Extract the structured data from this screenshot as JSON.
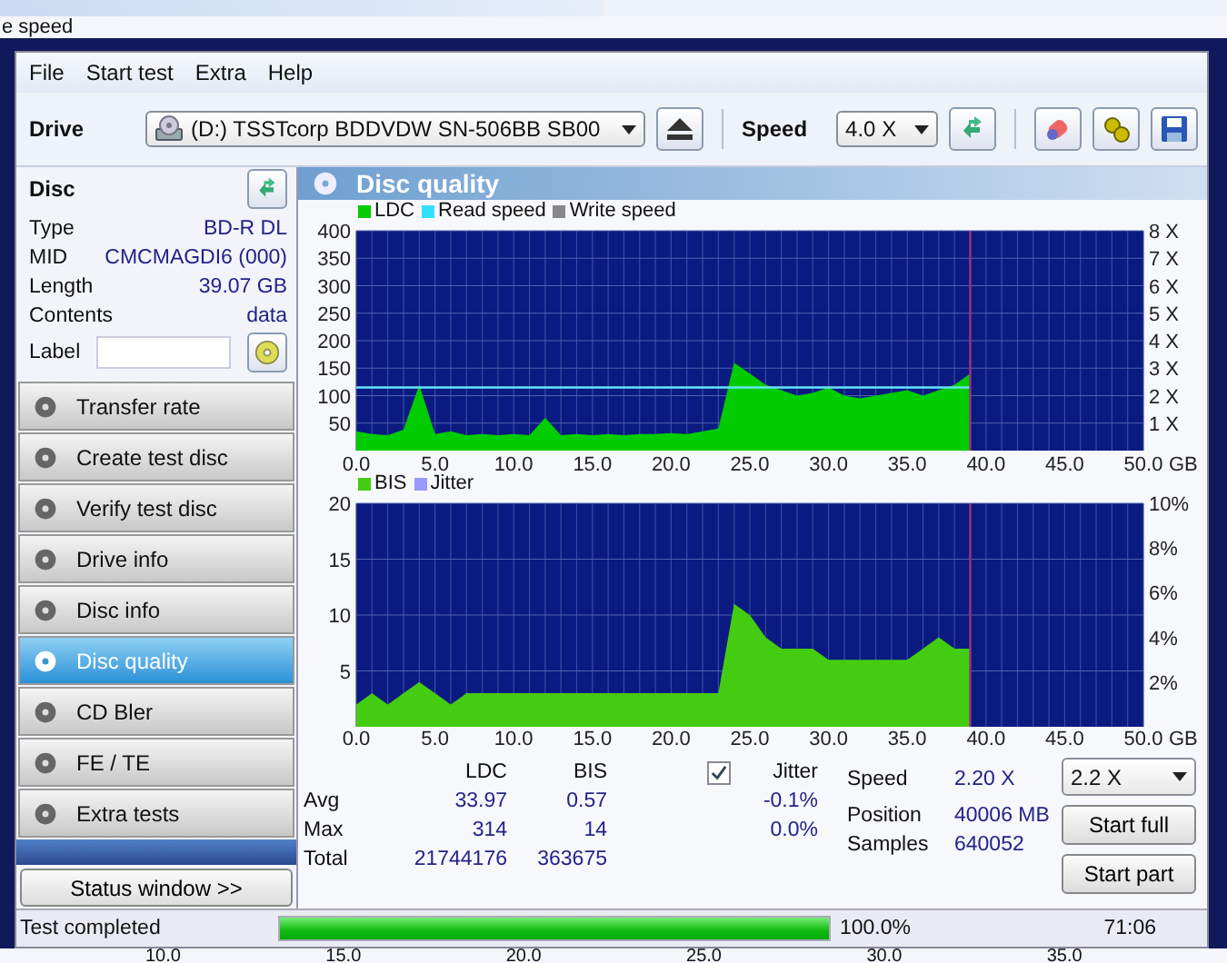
{
  "background": {
    "caption": "e speed",
    "axis_labels": [
      "10.0",
      "15.0",
      "20.0",
      "25.0",
      "30.0",
      "35.0"
    ]
  },
  "menu": [
    "File",
    "Start test",
    "Extra",
    "Help"
  ],
  "toolbar": {
    "drive_label": "Drive",
    "drive": "(D:)   TSSTcorp BDDVDW SN-506BB SB00",
    "speed_label": "Speed",
    "speed": "4.0 X"
  },
  "disc": {
    "title": "Disc",
    "info": [
      {
        "label": "Type",
        "value": "BD-R DL"
      },
      {
        "label": "MID",
        "value": "CMCMAGDI6 (000)"
      },
      {
        "label": "Length",
        "value": "39.07 GB"
      },
      {
        "label": "Contents",
        "value": "data"
      }
    ],
    "label_field": "Label"
  },
  "tests": [
    {
      "label": "Transfer rate",
      "selected": false
    },
    {
      "label": "Create test disc",
      "selected": false
    },
    {
      "label": "Verify test disc",
      "selected": false
    },
    {
      "label": "Drive info",
      "selected": false
    },
    {
      "label": "Disc info",
      "selected": false
    },
    {
      "label": "Disc quality",
      "selected": true
    },
    {
      "label": "CD Bler",
      "selected": false
    },
    {
      "label": "FE / TE",
      "selected": false
    },
    {
      "label": "Extra tests",
      "selected": false
    }
  ],
  "status_window_button": "Status window >>",
  "panel_title": "Disc quality",
  "chart1": {
    "extra_legend": [
      {
        "label": "Read speed",
        "color": "#33e0ff"
      },
      {
        "label": "Write speed",
        "color": "#888888"
      }
    ],
    "x_unit": "GB",
    "y2ticks": [
      "8 X",
      "7 X",
      "6 X",
      "5 X",
      "4 X",
      "3 X",
      "2 X",
      "1 X"
    ],
    "chart_data": {
      "type": "area",
      "grid": true,
      "x": [
        0,
        1,
        2,
        3,
        4,
        5,
        6,
        7,
        8,
        9,
        10,
        11,
        12,
        13,
        14,
        15,
        16,
        17,
        18,
        19,
        20,
        21,
        22,
        23,
        24,
        25,
        26,
        27,
        28,
        29,
        30,
        31,
        32,
        33,
        34,
        35,
        36,
        37,
        38,
        39
      ],
      "series": [
        {
          "name": "LDC",
          "color": "#00cc00",
          "values": [
            35,
            30,
            28,
            38,
            120,
            30,
            35,
            28,
            30,
            28,
            30,
            28,
            60,
            28,
            30,
            28,
            30,
            28,
            30,
            30,
            32,
            30,
            35,
            40,
            160,
            140,
            120,
            110,
            100,
            105,
            115,
            100,
            95,
            100,
            105,
            110,
            100,
            110,
            120,
            140
          ]
        }
      ],
      "xlim": [
        0,
        50
      ],
      "ylim": [
        0,
        400
      ],
      "xticks": [
        {
          "value": 0,
          "label": "0.0"
        },
        {
          "value": 5,
          "label": "5.0"
        },
        {
          "value": 10,
          "label": "10.0"
        },
        {
          "value": 15,
          "label": "15.0"
        },
        {
          "value": 20,
          "label": "20.0"
        },
        {
          "value": 25,
          "label": "25.0"
        },
        {
          "value": 30,
          "label": "30.0"
        },
        {
          "value": 35,
          "label": "35.0"
        },
        {
          "value": 40,
          "label": "40.0"
        },
        {
          "value": 45,
          "label": "45.0"
        },
        {
          "value": 50,
          "label": "50.0"
        }
      ],
      "yticks": [
        50,
        100,
        150,
        200,
        250,
        300,
        350,
        400
      ],
      "ref_lines": [
        {
          "axis": "y",
          "value": 115,
          "color": "#66e6ff"
        },
        {
          "axis": "x",
          "value": 39,
          "color": "#a03080"
        }
      ]
    }
  },
  "chart2": {
    "extra_legend": [
      {
        "label": "Jitter",
        "color": "#9999ff"
      }
    ],
    "x_unit": "GB",
    "y2ticks": [
      "10%",
      "8%",
      "6%",
      "4%",
      "2%"
    ],
    "chart_data": {
      "type": "area",
      "grid": true,
      "x": [
        0,
        1,
        2,
        3,
        4,
        5,
        6,
        7,
        8,
        9,
        10,
        11,
        12,
        13,
        14,
        15,
        16,
        17,
        18,
        19,
        20,
        21,
        22,
        23,
        24,
        25,
        26,
        27,
        28,
        29,
        30,
        31,
        32,
        33,
        34,
        35,
        36,
        37,
        38,
        39
      ],
      "series": [
        {
          "name": "BIS",
          "color": "#44cc11",
          "values": [
            2,
            3,
            2,
            3,
            4,
            3,
            2,
            3,
            3,
            3,
            3,
            3,
            3,
            3,
            3,
            3,
            3,
            3,
            3,
            3,
            3,
            3,
            3,
            3,
            11,
            10,
            8,
            7,
            7,
            7,
            6,
            6,
            6,
            6,
            6,
            6,
            7,
            8,
            7,
            7
          ]
        }
      ],
      "xlim": [
        0,
        50
      ],
      "ylim": [
        0,
        20
      ],
      "xticks": [
        {
          "value": 0,
          "label": "0.0"
        },
        {
          "value": 5,
          "label": "5.0"
        },
        {
          "value": 10,
          "label": "10.0"
        },
        {
          "value": 15,
          "label": "15.0"
        },
        {
          "value": 20,
          "label": "20.0"
        },
        {
          "value": 25,
          "label": "25.0"
        },
        {
          "value": 30,
          "label": "30.0"
        },
        {
          "value": 35,
          "label": "35.0"
        },
        {
          "value": 40,
          "label": "40.0"
        },
        {
          "value": 45,
          "label": "45.0"
        },
        {
          "value": 50,
          "label": "50.0"
        }
      ],
      "yticks": [
        5,
        10,
        15,
        20
      ],
      "ref_lines": [
        {
          "axis": "x",
          "value": 39,
          "color": "#a03080"
        }
      ]
    }
  },
  "stats": {
    "columns": [
      "LDC",
      "BIS"
    ],
    "rows": [
      {
        "label": "Avg",
        "values": [
          "33.97",
          "0.57"
        ],
        "jitter": "-0.1%"
      },
      {
        "label": "Max",
        "values": [
          "314",
          "14"
        ],
        "jitter": "0.0%"
      },
      {
        "label": "Total",
        "values": [
          "21744176",
          "363675"
        ]
      }
    ],
    "jitter": {
      "label": "Jitter",
      "checked": true
    }
  },
  "run": {
    "info": [
      {
        "label": "Speed",
        "value": "2.20 X"
      },
      {
        "label": "Position",
        "value": "40006 MB"
      },
      {
        "label": "Samples",
        "value": "640052"
      }
    ],
    "speed": "2.2 X",
    "buttons": [
      "Start full",
      "Start part"
    ]
  },
  "status_bar": {
    "text": "Test completed",
    "level": 1,
    "percent": "100.0%",
    "time": "71:06"
  }
}
